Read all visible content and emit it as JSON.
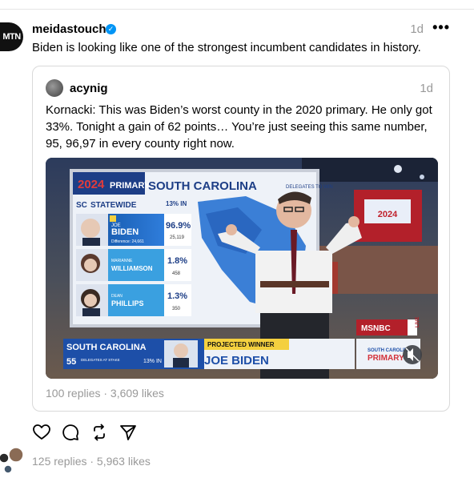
{
  "post": {
    "username": "meidastouch",
    "avatar_text": "MTN",
    "time": "1d",
    "more": "•••",
    "text": "Biden is looking like one of the strongest incumbent candidates in history.",
    "stats": "125 replies · 5,963 likes"
  },
  "quote": {
    "username": "acynig",
    "time": "1d",
    "text": "Kornacki: This was Biden’s worst county in the 2020 primary. He only got 33%. Tonight a gain of 62 points… You’re just seeing this same number, 95, 96,97 in every county right now.",
    "stats": "100 replies · 3,609 likes"
  },
  "video": {
    "banner_year": "2024",
    "banner_primary": "PRIMARY",
    "banner_state": "SOUTH CAROLINA",
    "sc_label": "SC",
    "statewide": "STATEWIDE",
    "reporting": "13% IN",
    "delegates_to_win": "DELEGATES TO WIN",
    "candidates": [
      {
        "first": "JOE",
        "last": "BIDEN",
        "pct": "96.9%",
        "votes": "25,119",
        "extra": "Difference: 24,661"
      },
      {
        "first": "MARIANNE",
        "last": "WILLIAMSON",
        "pct": "1.8%",
        "votes": "458",
        "extra": ""
      },
      {
        "first": "DEAN",
        "last": "PHILLIPS",
        "pct": "1.3%",
        "votes": "350",
        "extra": ""
      }
    ],
    "lower_state": "SOUTH CAROLINA",
    "lower_delegates_num": "55",
    "lower_delegates_label": "DELEGATES AT STAKE",
    "lower_reporting": "13% IN",
    "projected": "PROJECTED WINNER",
    "winner": "JOE BIDEN",
    "network": "MSNBC",
    "live": "LIVE",
    "sc_primary_1": "SOUTH CAROLINA",
    "sc_primary_2": "PRIMARY",
    "bg_year": "2024"
  },
  "colors": {
    "accent_blue": "#0095f6",
    "meta_gray": "#999999",
    "dem_blue": "#1a5fb4",
    "projected_yellow": "#f4d03f"
  }
}
